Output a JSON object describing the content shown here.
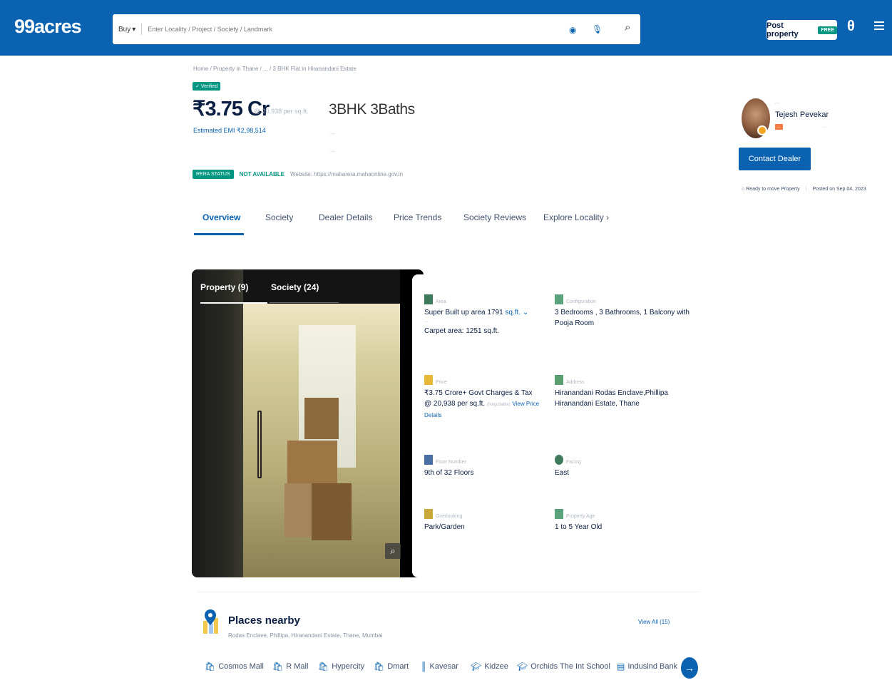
{
  "header": {
    "logo": "99acres",
    "search_mode": "Buy",
    "search_placeholder": "Enter Locality / Project / Society / Landmark",
    "post_property": "Post property",
    "free_badge": "FREE"
  },
  "breadcrumb": "Home / Property in Thane / ... / 3 BHK Flat in Hiranandani Estate",
  "verified": "Verified",
  "listing": {
    "price": "₹3.75 Cr",
    "price_per": "@ 20,938 per sq.ft.",
    "emi": "Estimated EMI ₹2,98,514",
    "config": "3BHK 3Baths",
    "meta1": "...",
    "meta2": "..."
  },
  "rera": {
    "status_label": "RERA STATUS",
    "status_value": "NOT AVAILABLE",
    "website": "Website: https://maharera.mahaonline.gov.in"
  },
  "tabs": [
    "Overview",
    "Society",
    "Dealer Details",
    "Price Trends",
    "Society Reviews",
    "Explore Locality"
  ],
  "dealer": {
    "top": "...",
    "name": "Tejesh Pevekar",
    "tag": "...",
    "tag2": "...",
    "contact": "Contact Dealer",
    "ready": "Ready to move Property",
    "posted": "Posted on Sep 04, 2023"
  },
  "gallery": {
    "property_tab": "Property (9)",
    "society_tab": "Society (24)"
  },
  "details": {
    "area_label": "Area",
    "super_area": "Super Built up area 1791",
    "unit": "sq.ft.",
    "carpet_label": "...",
    "carpet_area": "Carpet area: 1251 sq.ft.",
    "config_label": "Configuration",
    "config_value": "3 Bedrooms , 3 Bathrooms, 1 Balcony with Pooja Room",
    "price_label": "Price",
    "price_value": "₹3.75 Crore+ Govt Charges & Tax",
    "price_per": "@ 20,938 per sq.ft.",
    "negotiable": "(Negotiable)",
    "view_details": "View Price Details",
    "address_label": "Address",
    "address_value": "Hiranandani Rodas Enclave,Phillipa Hiranandani Estate, Thane",
    "floor_label": "Floor Number",
    "floor_value": "9th of 32 Floors",
    "facing_label": "Facing",
    "facing_value": "East",
    "overlooking_label": "Overlooking",
    "overlooking_value": "Park/Garden",
    "age_label": "Property Age",
    "age_value": "1 to 5 Year Old"
  },
  "places": {
    "title": "Places nearby",
    "subtitle": "Rodas Enclave, Phillipa, Hiranandani Estate, Thane, Mumbai",
    "view_all": "View All (15)",
    "chips": [
      "Cosmos Mall",
      "R Mall",
      "Hypercity",
      "Dmart",
      "Kavesar",
      "Kidzee",
      "Orchids The Int School",
      "Indusind Bank"
    ]
  }
}
